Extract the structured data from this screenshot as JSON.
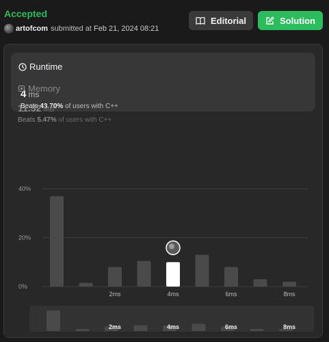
{
  "submission": {
    "status": "Accepted",
    "username": "artofcom",
    "submitted_text": "submitted at",
    "submitted_time": "Feb 21, 2024 08:21"
  },
  "buttons": {
    "editorial_label": "Editorial",
    "solution_label": "Solution"
  },
  "runtime": {
    "title": "Runtime",
    "value": "4",
    "unit": "ms",
    "beats_label": "Beats",
    "beats_pct": "43.70%",
    "beats_suffix": "of users with C++"
  },
  "memory": {
    "title": "Memory",
    "value": "11.32",
    "unit": "MB",
    "beats_label": "Beats",
    "beats_pct": "5.47%",
    "beats_suffix": "of users with C++"
  },
  "colors": {
    "accepted": "#2cbb5d",
    "bar": "#4a4a4a",
    "bar_selected": "#ffffff"
  },
  "chart_data": {
    "type": "bar",
    "y_ticks": [
      "40%",
      "20%",
      "0%"
    ],
    "ylim": [
      0,
      40
    ],
    "x_tick_labels": [
      "2ms",
      "4ms",
      "6ms",
      "8ms"
    ],
    "x_tick_positions": [
      2,
      4,
      6,
      8
    ],
    "x": [
      0,
      1,
      2,
      3,
      4,
      5,
      6,
      7,
      8
    ],
    "values": [
      37,
      1.5,
      8,
      10.5,
      10,
      13,
      8,
      3,
      2
    ],
    "selected_x": 4
  }
}
